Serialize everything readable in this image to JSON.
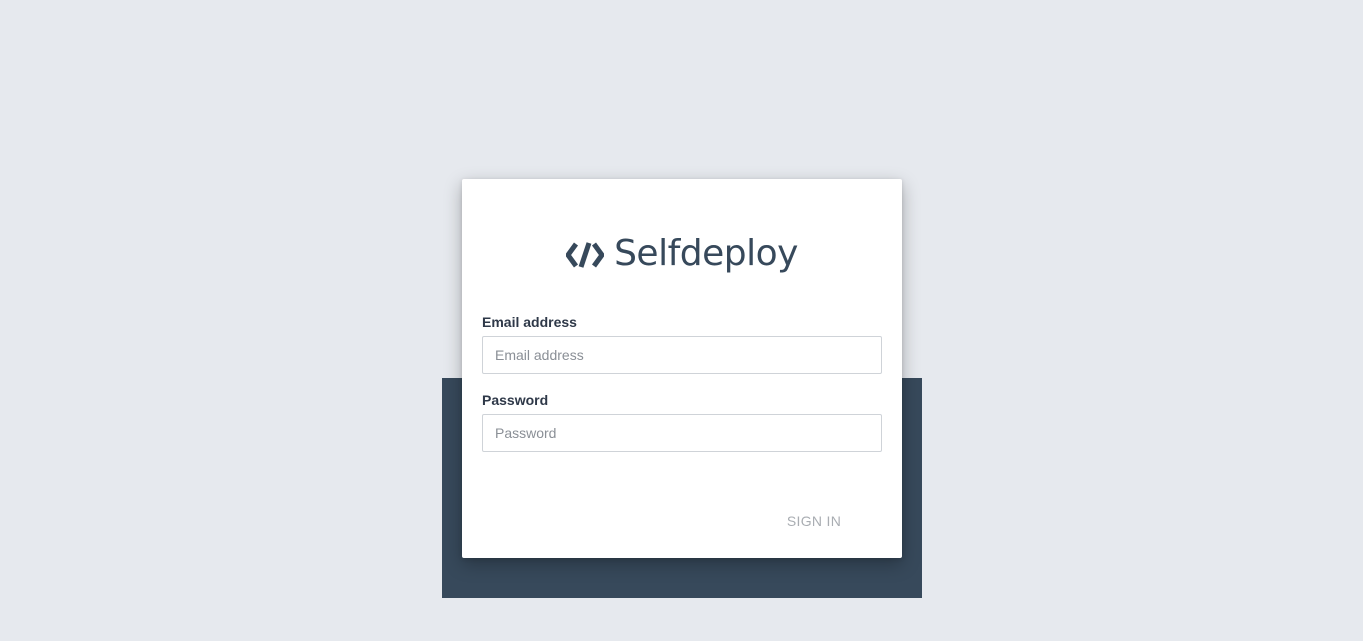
{
  "brand": {
    "name": "Selfdeploy",
    "logo_icon": "code-chevrons-icon",
    "color": "#37495b"
  },
  "form": {
    "email": {
      "label": "Email address",
      "placeholder": "Email address",
      "value": ""
    },
    "password": {
      "label": "Password",
      "placeholder": "Password",
      "value": ""
    },
    "submit_label": "SIGN IN"
  },
  "colors": {
    "background": "#e6e9ee",
    "backdrop": "#37495b",
    "card": "#ffffff",
    "disabled_text": "#a9adb2"
  }
}
